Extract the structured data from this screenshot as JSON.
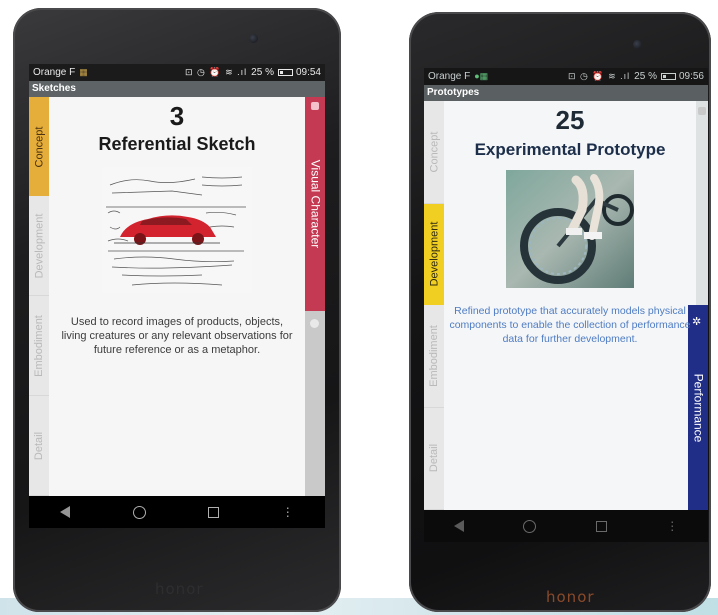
{
  "left_phone": {
    "brand": "honor",
    "status": {
      "carrier": "Orange F",
      "battery": "25 %",
      "time": "09:54",
      "icons": "⊡ ◷ ⏰ ≋ .ıl"
    },
    "app_title": "Sketches",
    "tabs_left": [
      "Concept",
      "Development",
      "Embodiment",
      "Detail"
    ],
    "active_tab": "Concept",
    "tab_right": "Visual Character",
    "card": {
      "number": "3",
      "title": "Referential Sketch",
      "description": "Used to record images of products, objects, living creatures or any relevant observations for future reference or as a metaphor."
    },
    "colors": {
      "active_tab": "#e5ad3a",
      "right_tab": "#c43a53",
      "title_bar": "#5e6466"
    }
  },
  "right_phone": {
    "brand": "honor",
    "status": {
      "carrier": "Orange F",
      "battery": "25 %",
      "time": "09:56",
      "icons": "⊡ ◷ ⏰ ≋ .ıl"
    },
    "app_title": "Prototypes",
    "tabs_left": [
      "Concept",
      "Development",
      "Embodiment",
      "Detail"
    ],
    "active_tab": "Development",
    "tab_right": "Performance",
    "card": {
      "number": "25",
      "title": "Experimental Prototype",
      "description": "Refined prototype that accurately models physical components to enable the collection of performance data for further development."
    },
    "colors": {
      "active_tab": "#f1cf22",
      "right_tab": "#212e87",
      "title_bar": "#5a5f61"
    }
  },
  "icons": [
    "back-icon",
    "home-icon",
    "recent-apps-icon",
    "more-icon",
    "battery-icon",
    "gear-icon"
  ]
}
